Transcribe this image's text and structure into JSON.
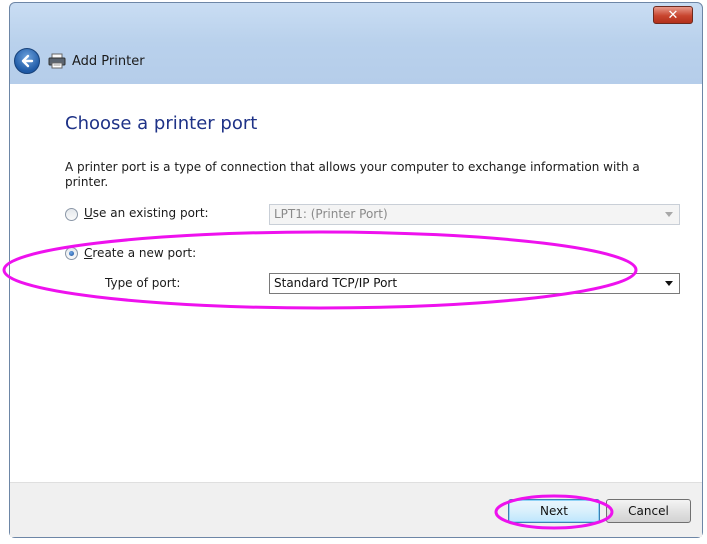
{
  "window": {
    "title": "Add Printer",
    "close_label": "✕"
  },
  "page": {
    "heading": "Choose a printer port",
    "description": "A printer port is a type of connection that allows your computer to exchange information with a printer."
  },
  "options": {
    "existing": {
      "label_accel": "U",
      "label_rest": "se an existing port:",
      "selected": false,
      "value": "LPT1: (Printer Port)"
    },
    "new_port": {
      "label_accel": "C",
      "label_rest": "reate a new port:",
      "selected": true,
      "type_label": "Type of port:",
      "value": "Standard TCP/IP Port"
    }
  },
  "buttons": {
    "next": "Next",
    "cancel": "Cancel"
  },
  "colors": {
    "highlight": "#ee11ee",
    "heading": "#1e3287"
  }
}
